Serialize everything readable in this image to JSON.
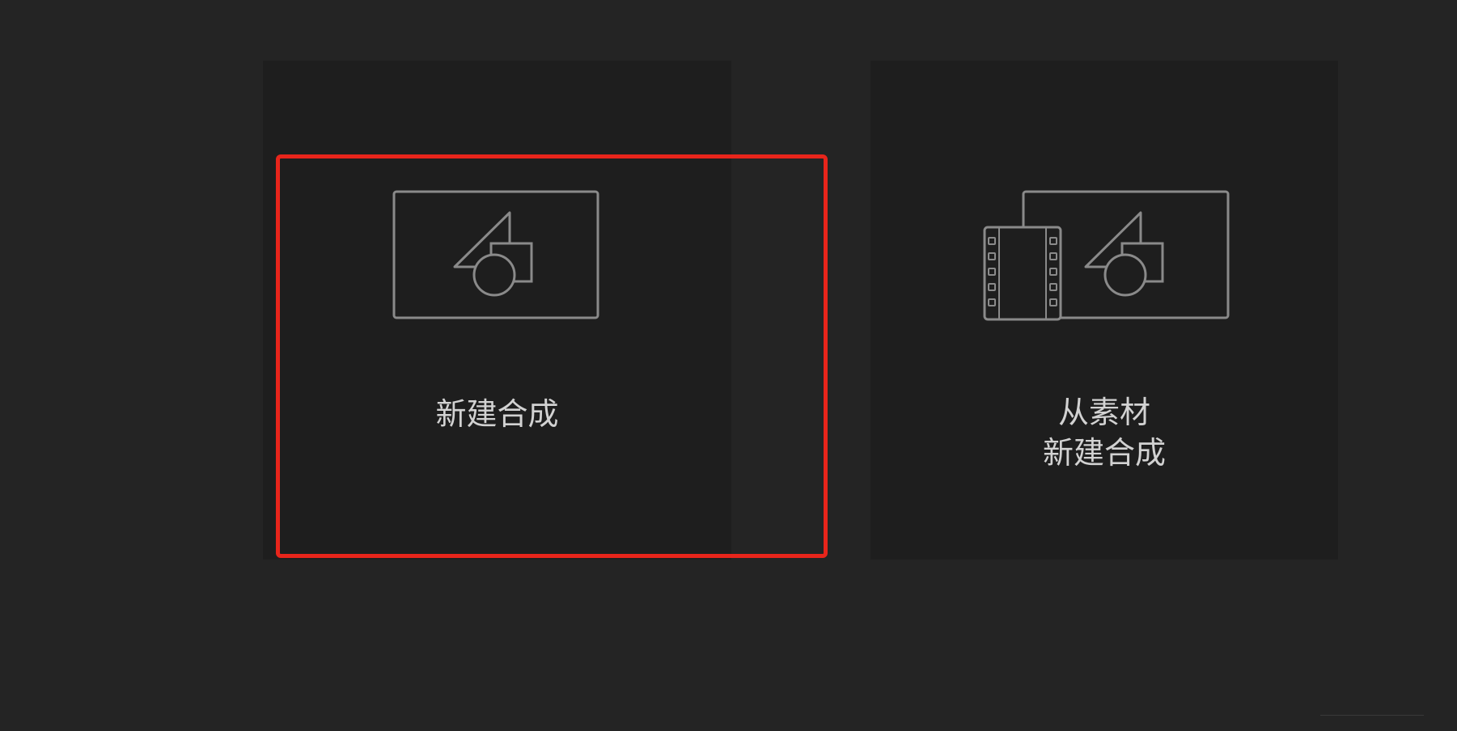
{
  "cards": {
    "new_composition": {
      "label": "新建合成",
      "icon": "composition-icon"
    },
    "from_footage": {
      "label": "从素材\n新建合成",
      "icon": "composition-from-footage-icon"
    }
  },
  "colors": {
    "background": "#242424",
    "card": "#1e1e1e",
    "icon_stroke": "#8a8a8a",
    "label": "#d2d2d2",
    "highlight": "#e8251b"
  }
}
